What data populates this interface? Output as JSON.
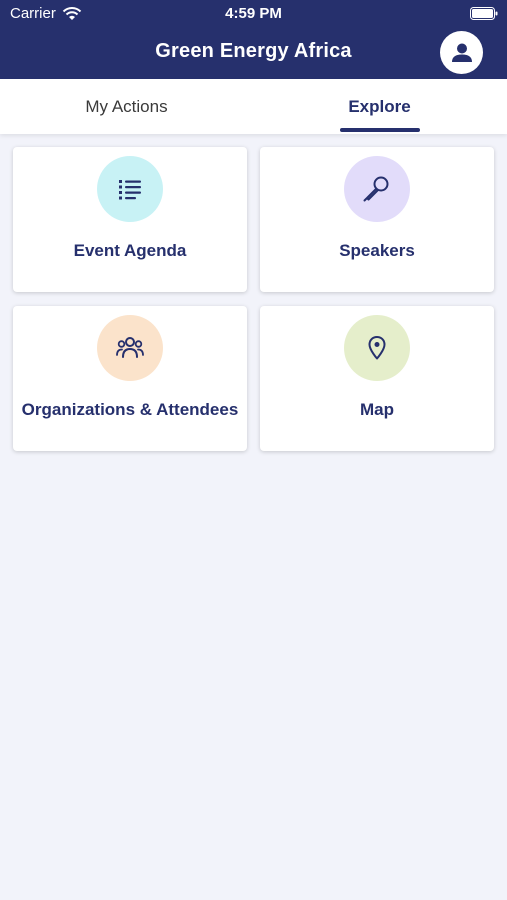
{
  "status_bar": {
    "carrier": "Carrier",
    "time": "4:59 PM"
  },
  "header": {
    "title": "Green Energy Africa",
    "profile_icon": "user-icon"
  },
  "tabs": [
    {
      "label": "My Actions",
      "active": false
    },
    {
      "label": "Explore",
      "active": true
    }
  ],
  "cards": [
    {
      "label": "Event Agenda",
      "icon": "list-icon",
      "color": "#c8f2f5"
    },
    {
      "label": "Speakers",
      "icon": "microphone-icon",
      "color": "#e2dcfa"
    },
    {
      "label": "Organizations & Attendees",
      "icon": "people-icon",
      "color": "#fbe3cb"
    },
    {
      "label": "Map",
      "icon": "location-pin-icon",
      "color": "#e5eecb"
    }
  ],
  "colors": {
    "primary": "#26306d",
    "background": "#f2f3fa"
  }
}
